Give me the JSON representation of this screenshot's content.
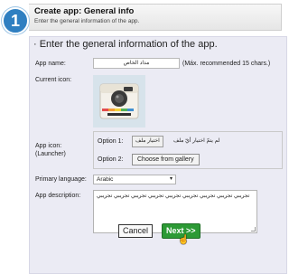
{
  "step": {
    "number": "1",
    "title": "Create app: General info",
    "subtitle": "Enter the general information of the app."
  },
  "panel": {
    "title": "· Enter the general information of the app."
  },
  "app_name": {
    "label": "App name:",
    "value": "مداد الخاص",
    "max_note": "(Máx. recommended 15 chars.)"
  },
  "current_icon": {
    "label": "Current icon:"
  },
  "app_icon": {
    "label_line1": "App icon:",
    "label_line2": "(Launcher)",
    "option1_label": "Option 1:",
    "file_button": "اختيار ملف",
    "file_status": "لم يتمّ اختيار أيّ ملف",
    "option2_label": "Option 2:",
    "gallery_button": "Choose from gallery"
  },
  "primary_language": {
    "label": "Primary language:",
    "selected": "Arabic"
  },
  "app_description": {
    "label": "App description:",
    "value": "تجريبي تجريبي تجريبي تجريبي تجريبي تجريبي تجريبي تجريبي تجريبي"
  },
  "actions": {
    "cancel": "Cancel",
    "next": "Next >>"
  },
  "colors": {
    "accent": "#2f7fc1",
    "panel_bg": "#ebebf4",
    "next_bg": "#2c9a35"
  },
  "icons": {
    "app_icon": "polaroid-camera-icon",
    "select_chevron": "chevron-down-icon",
    "cursor": "hand-pointer-icon"
  }
}
